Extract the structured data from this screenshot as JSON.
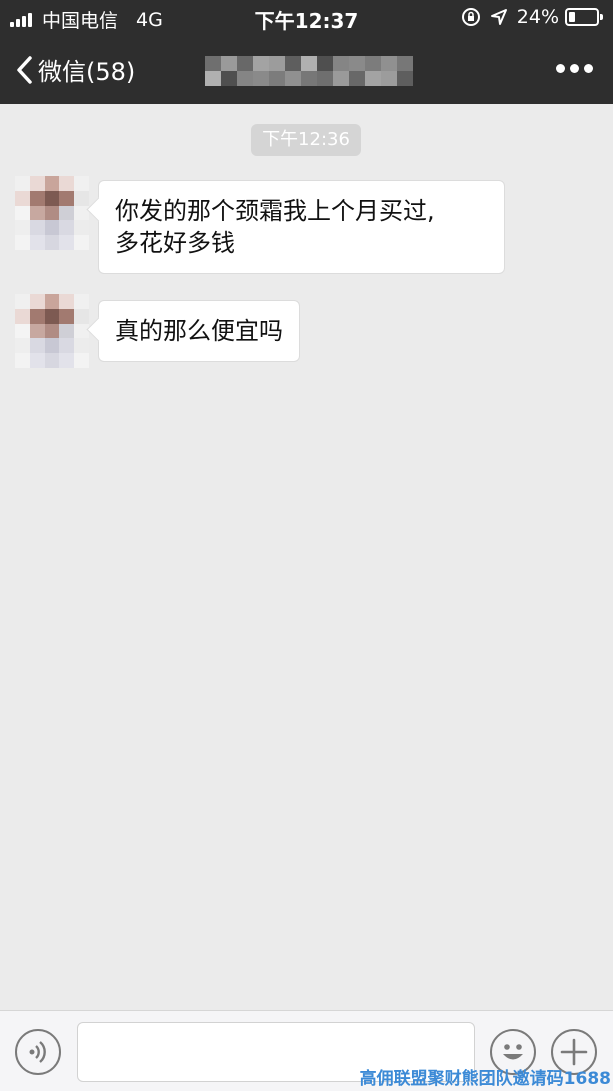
{
  "status_bar": {
    "carrier": "中国电信",
    "network": "4G",
    "time": "下午12:37",
    "battery_percent": "24%",
    "battery_level": 0.24,
    "icons": [
      "signal-icon",
      "orientation-lock-icon",
      "location-arrow-icon",
      "battery-icon"
    ]
  },
  "nav": {
    "back_label": "微信(58)",
    "title_redacted": true,
    "more_icon": "more-dots-icon"
  },
  "chat": {
    "timestamp": "下午12:36",
    "messages": [
      {
        "sender": "incoming",
        "lines": [
          "你发的那个颈霜我上个月买过,",
          "多花好多钱"
        ]
      },
      {
        "sender": "incoming",
        "lines": [
          "真的那么便宜吗"
        ]
      }
    ]
  },
  "input_bar": {
    "placeholder": "",
    "icons": [
      "voice-icon",
      "emoji-icon",
      "plus-icon"
    ]
  },
  "watermark": "高佣联盟聚财熊团队邀请码1688"
}
